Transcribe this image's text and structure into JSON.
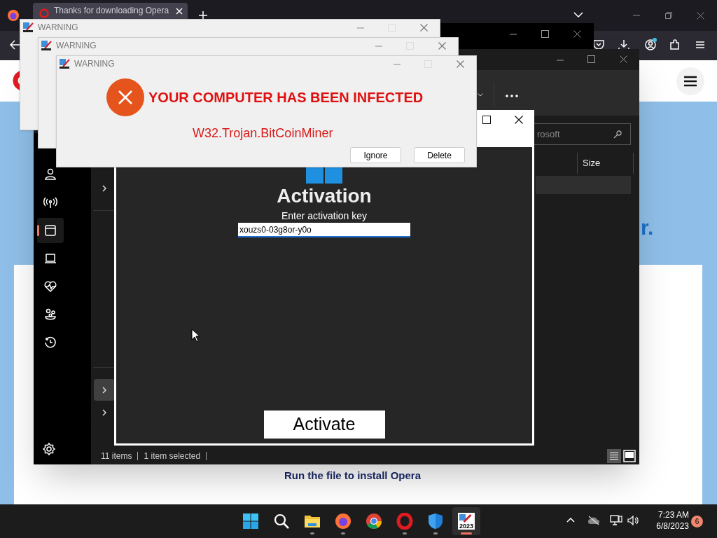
{
  "browser": {
    "tab_title": "Thanks for downloading Opera"
  },
  "page": {
    "heading_fragment": "r.",
    "install_text": "Run the file to install Opera"
  },
  "explorer": {
    "search_value": "rosoft",
    "column": "Size",
    "sidebar": [
      {
        "kind": "person",
        "selected": false
      },
      {
        "kind": "antenna",
        "selected": false
      },
      {
        "kind": "window",
        "selected": true
      },
      {
        "kind": "laptop",
        "selected": false
      },
      {
        "kind": "heart",
        "selected": false
      },
      {
        "kind": "family",
        "selected": false
      },
      {
        "kind": "history",
        "selected": false
      }
    ],
    "nav_chevrons": [
      {
        "selected": false
      },
      {
        "selected": true
      },
      {
        "selected": false
      }
    ],
    "status": [
      "11 items",
      "1 item selected"
    ]
  },
  "activation": {
    "title": "Activation",
    "prompt": "Enter activation key",
    "key_value": "xouzs0-03g8or-y0o",
    "button": "Activate"
  },
  "warning_windows": [
    {
      "title": "WARNING"
    },
    {
      "title": "WARNING"
    },
    {
      "title": "WARNING"
    }
  ],
  "alert": {
    "heading": "YOUR COMPUTER HAS BEEN INFECTED",
    "message": "W32.Trojan.BitCoinMiner",
    "buttons": [
      "Ignore",
      "Delete"
    ]
  },
  "taskbar": {
    "apps": [
      {
        "kind": "start",
        "running": false,
        "selected": false
      },
      {
        "kind": "search",
        "running": false,
        "selected": false
      },
      {
        "kind": "files",
        "running": true,
        "selected": false
      },
      {
        "kind": "firefox",
        "running": true,
        "selected": false
      },
      {
        "kind": "chrome",
        "running": false,
        "selected": false
      },
      {
        "kind": "opera",
        "running": true,
        "selected": false
      },
      {
        "kind": "defender",
        "running": true,
        "selected": false
      },
      {
        "kind": "app2023",
        "label": "2023",
        "running": true,
        "selected": true
      }
    ],
    "time": "7:23 AM",
    "date": "6/8/2023",
    "notifications": "6"
  }
}
